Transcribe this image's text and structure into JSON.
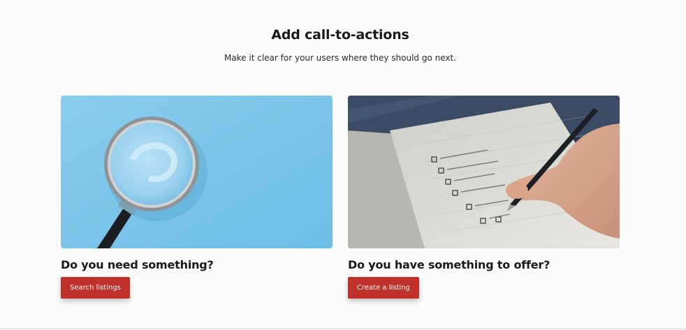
{
  "header": {
    "title": "Add call-to-actions",
    "subtitle": "Make it clear for your users where they should go next."
  },
  "cards": [
    {
      "image": "magnifying-glass-on-blue-photo",
      "heading": "Do you need something?",
      "button_label": "Search listings"
    },
    {
      "image": "hand-writing-checklist-photo",
      "heading": "Do you have something to offer?",
      "button_label": "Create a listing"
    }
  ],
  "colors": {
    "accent": "#c0312a",
    "background": "#fcfcfc",
    "heading_text": "#1a1a1a",
    "image_blue": "#7ec6ea"
  }
}
